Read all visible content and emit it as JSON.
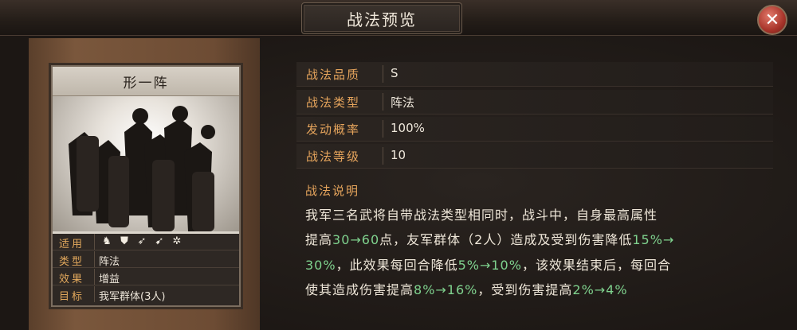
{
  "header": {
    "title": "战法预览"
  },
  "card": {
    "name": "形一阵",
    "rows": {
      "applicable_label": "适用",
      "type_label": "类型",
      "type_value": "阵法",
      "effect_label": "效果",
      "effect_value": "增益",
      "target_label": "目标",
      "target_value": "我军群体(3人)"
    },
    "unit_icons": [
      "horse-icon",
      "shield-icon",
      "bow-icon",
      "spear-icon",
      "chariot-icon"
    ]
  },
  "details": {
    "quality_label": "战法品质",
    "quality_value": "S",
    "type_label": "战法类型",
    "type_value": "阵法",
    "chance_label": "发动概率",
    "chance_value": "100%",
    "level_label": "战法等级",
    "level_value": "10",
    "desc_label": "战法说明"
  },
  "description": {
    "l1": "我军三名武将自带战法类型相同时，战斗中，自身最高属性",
    "l2a": "提高",
    "l2b": "30→60",
    "l2c": "点，友军群体（2人）造成及受到伤害降低",
    "l2d": "15%→",
    "l3a": "30%",
    "l3b": "，此效果每回合降低",
    "l3c": "5%→10%",
    "l3d": "，该效果结束后，每回合",
    "l4a": "使其造成伤害提高",
    "l4b": "8%→16%",
    "l4c": "，受到伤害提高",
    "l4d": "2%→4%"
  },
  "colors": {
    "accent": "#e5a45c",
    "highlight": "#7fd28e"
  }
}
